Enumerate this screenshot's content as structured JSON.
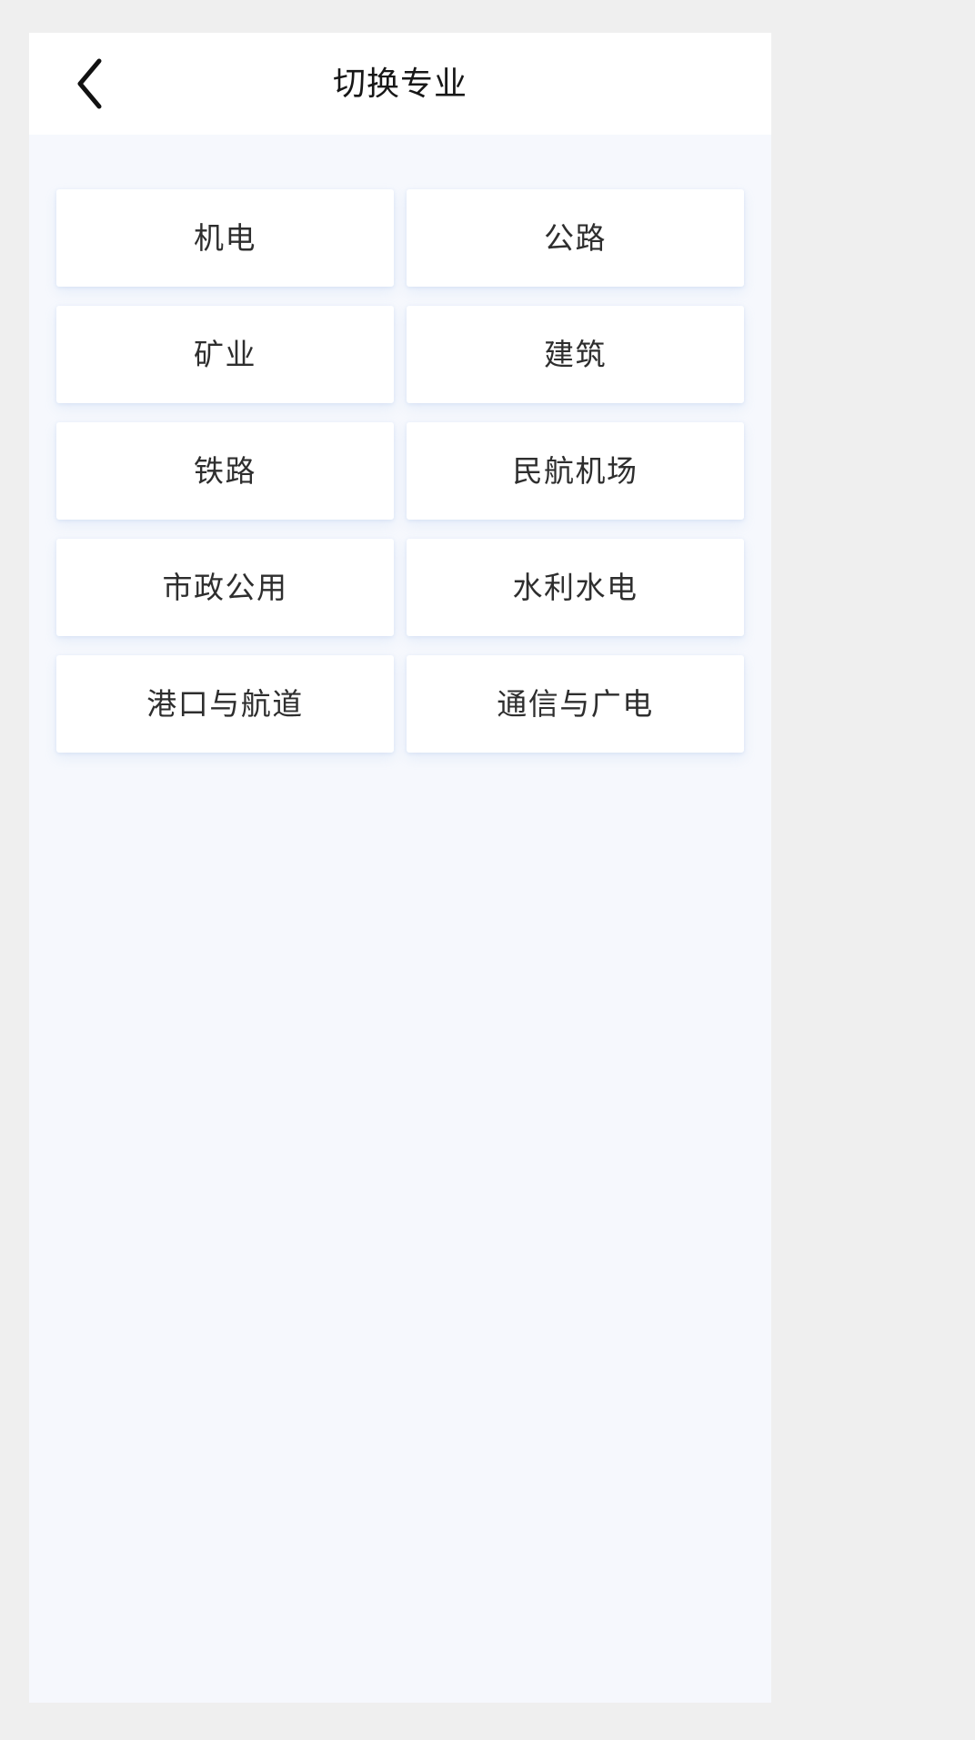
{
  "header": {
    "title": "切换专业",
    "back_icon": "chevron-left-icon"
  },
  "colors": {
    "page_background": "#efefef",
    "screen_background": "#f6f8fd",
    "card_background": "#ffffff",
    "title_text": "#171717",
    "label_text": "#2e2e2e",
    "card_glow": "#dce9f8"
  },
  "majors": [
    {
      "label": "机电"
    },
    {
      "label": "公路"
    },
    {
      "label": "矿业"
    },
    {
      "label": "建筑"
    },
    {
      "label": "铁路"
    },
    {
      "label": "民航机场"
    },
    {
      "label": "市政公用"
    },
    {
      "label": "水利水电"
    },
    {
      "label": "港口与航道"
    },
    {
      "label": "通信与广电"
    }
  ]
}
